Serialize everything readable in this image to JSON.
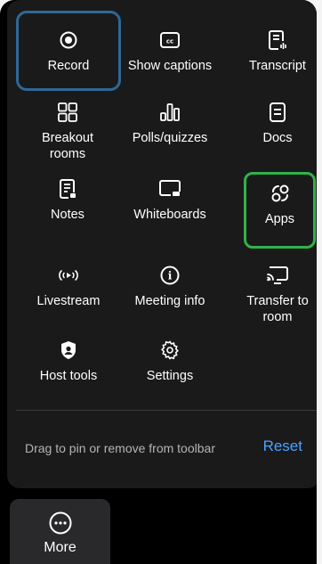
{
  "items": [
    {
      "label": "Record",
      "icon": "record-icon"
    },
    {
      "label": "Show captions",
      "icon": "captions-icon"
    },
    {
      "label": "Transcript",
      "icon": "transcript-icon"
    },
    {
      "label": "Breakout rooms",
      "icon": "breakout-rooms-icon"
    },
    {
      "label": "Polls/quizzes",
      "icon": "polls-icon"
    },
    {
      "label": "Docs",
      "icon": "docs-icon"
    },
    {
      "label": "Notes",
      "icon": "notes-icon"
    },
    {
      "label": "Whiteboards",
      "icon": "whiteboard-icon"
    },
    {
      "label": "Apps",
      "icon": "apps-icon"
    },
    {
      "label": "Livestream",
      "icon": "livestream-icon"
    },
    {
      "label": "Meeting info",
      "icon": "info-icon"
    },
    {
      "label": "Transfer to room",
      "icon": "transfer-icon"
    },
    {
      "label": "Host tools",
      "icon": "shield-icon"
    },
    {
      "label": "Settings",
      "icon": "gear-icon"
    }
  ],
  "footer": {
    "hint": "Drag to pin or remove from toolbar",
    "reset_label": "Reset"
  },
  "more": {
    "label": "More",
    "icon": "more-icon"
  },
  "colors": {
    "record_highlight": "#2f6896",
    "apps_highlight": "#2fb34a",
    "reset_link": "#4aa2ff"
  }
}
